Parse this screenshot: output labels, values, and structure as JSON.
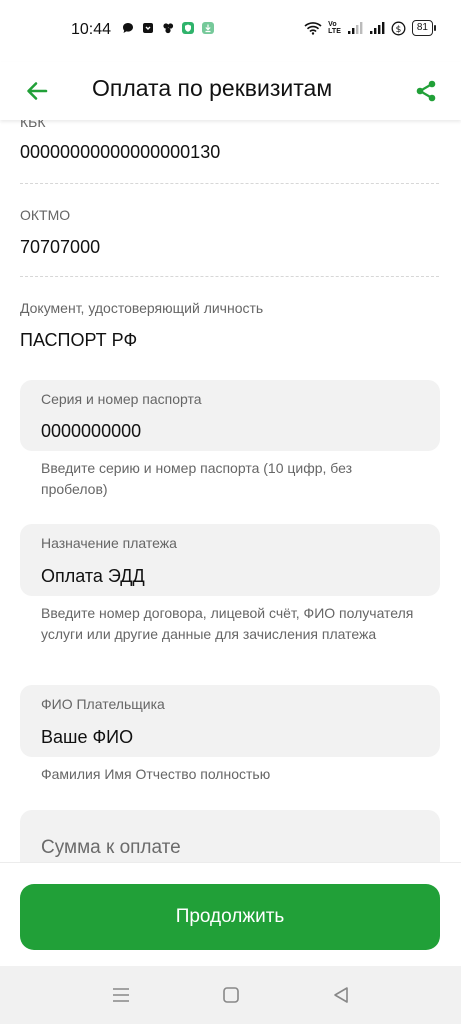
{
  "status_bar": {
    "time": "10:44",
    "battery": "81",
    "network_label_top": "Vo",
    "network_label_bottom": "LTE"
  },
  "app_bar": {
    "title": "Оплата по реквизитам",
    "back_icon": "arrow-left-icon",
    "share_icon": "share-icon",
    "accent": "#21a038"
  },
  "fields": {
    "kbk": {
      "label": "КБК",
      "value": "00000000000000000130"
    },
    "oktmo": {
      "label": "ОКТМО",
      "value": "70707000"
    },
    "document": {
      "label": "Документ, удостоверяющий личность",
      "value": "ПАСПОРТ РФ"
    }
  },
  "inputs": {
    "passport": {
      "label": "Серия и номер паспорта",
      "value": "0000000000",
      "hint": "Введите серию и номер паспорта (10 цифр, без пробелов)"
    },
    "purpose": {
      "label": "Назначение платежа",
      "value": "Оплата ЭДД",
      "hint": "Введите номер договора, лицевой счёт,  ФИО получателя услуги или другие данные для зачисления платежа"
    },
    "payer": {
      "label": "ФИО Плательщика",
      "value": "Ваше ФИО",
      "hint": "Фамилия Имя Отчество полностью"
    },
    "amount": {
      "placeholder": "Сумма к оплате"
    }
  },
  "continue_button": {
    "label": "Продолжить",
    "color": "#21a038"
  },
  "nav_bar": {
    "icons": [
      "menu-icon",
      "home-square-icon",
      "back-triangle-icon"
    ]
  }
}
